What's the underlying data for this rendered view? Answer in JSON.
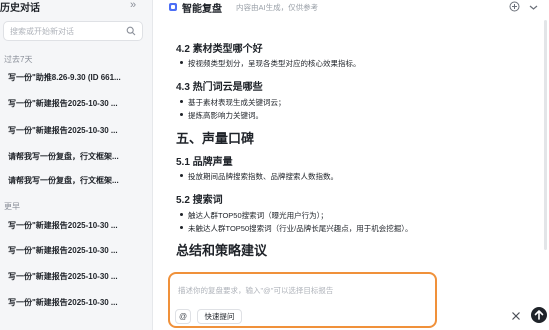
{
  "sidebar": {
    "title": "历史对话",
    "search_placeholder": "搜索或开始新对话",
    "groups": [
      {
        "label": "过去7天",
        "items": [
          "写一份\"助推8.26-9.30 (ID 661...",
          "写一份\"新建报告2025-10-30 ...",
          "写一份\"新建报告2025-10-30 ...",
          "请帮我写一份复盘，行文框架...",
          "请帮我写一份复盘，行文框架..."
        ]
      },
      {
        "label": "更早",
        "items": [
          "写一份\"新建报告2025-10-30 ...",
          "写一份\"新建报告2025-10-30 ...",
          "写一份\"新建报告2025-10-30 ...",
          "写一份\"新建报告2025-10-30 ..."
        ]
      }
    ]
  },
  "header": {
    "title": "智能复盘",
    "subtitle": "内容由AI生成，仅供参考"
  },
  "document": {
    "s42_title": "4.2 素材类型哪个好",
    "s42_items": [
      "按视频类型划分，呈现各类型对应的核心效果指标。"
    ],
    "s43_title": "4.3 热门词云是哪些",
    "s43_items": [
      "基于素材表现生成关键词云；",
      "提炼高影响力关键词。"
    ],
    "s5_title": "五、声量口碑",
    "s51_title": "5.1 品牌声量",
    "s51_items": [
      "投放期间品牌搜索指数、品牌搜索人数指数。"
    ],
    "s52_title": "5.2 搜索词",
    "s52_items": [
      "触达人群TOP50搜索词（曝光用户行为）；",
      "未触达人群TOP50搜索词（行业/品牌长尾兴趣点，用于机会挖掘）。"
    ],
    "summary_title": "总结和策略建议"
  },
  "composer": {
    "placeholder": "描述你的复盘要求，输入\"@\"可以选择目标报告",
    "at_label": "@",
    "quick_label": "快速提问"
  },
  "colors": {
    "accent": "#f0913a",
    "sidebar_bg": "#f5f6f8",
    "send": "#1f2329"
  }
}
